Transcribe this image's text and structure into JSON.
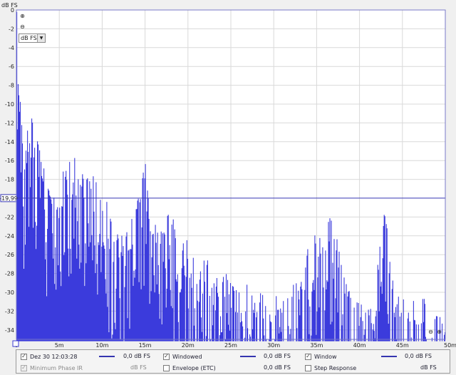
{
  "axis": {
    "y_unit": "dB FS",
    "x_unit": "s",
    "cursor_readout": "-19,99"
  },
  "unit_select": {
    "value": "dB FS"
  },
  "chart_data": {
    "type": "bar",
    "title": "",
    "ylabel": "dB FS",
    "xlabel": "s",
    "xlim": [
      0,
      50
    ],
    "ylim": [
      -35,
      0
    ],
    "y_ticks": [
      0,
      -2,
      -4,
      -6,
      -8,
      -10,
      -12,
      -14,
      -16,
      -18,
      -20,
      -22,
      -24,
      -26,
      -28,
      -30,
      -32,
      -34
    ],
    "y_tick_labels": [
      "0",
      "-2",
      "-4",
      "-6",
      "-8",
      "-10",
      "-12",
      "-14",
      "-16",
      "-18",
      "",
      "-22",
      "-24",
      "-26",
      "-28",
      "-30",
      "-32",
      "-34"
    ],
    "x_ticks": [
      0,
      5,
      10,
      15,
      20,
      25,
      30,
      35,
      40,
      45,
      50
    ],
    "x_tick_labels": [
      "0",
      "5m",
      "10m",
      "15m",
      "20m",
      "25m",
      "30m",
      "35m",
      "40m",
      "45m",
      "50m s"
    ],
    "grid": true,
    "cursor_level": -19.99,
    "series_color": "#3b3bdc",
    "envelope": [
      [
        0.0,
        -4
      ],
      [
        0.4,
        -9
      ],
      [
        1.0,
        -16
      ],
      [
        1.5,
        -10.5
      ],
      [
        2.0,
        -12
      ],
      [
        2.5,
        -14
      ],
      [
        3.0,
        -16
      ],
      [
        3.5,
        -18
      ],
      [
        4.0,
        -20
      ],
      [
        5.0,
        -19
      ],
      [
        6.0,
        -14
      ],
      [
        6.5,
        -17
      ],
      [
        7.0,
        -14.5
      ],
      [
        7.5,
        -17
      ],
      [
        8.0,
        -18
      ],
      [
        9.0,
        -17
      ],
      [
        9.5,
        -19
      ],
      [
        10.0,
        -21
      ],
      [
        10.5,
        -20
      ],
      [
        11.0,
        -22
      ],
      [
        12.0,
        -24
      ],
      [
        13.0,
        -22
      ],
      [
        14.0,
        -21
      ],
      [
        14.5,
        -17
      ],
      [
        15.0,
        -16
      ],
      [
        15.5,
        -19
      ],
      [
        16.0,
        -22
      ],
      [
        17.0,
        -23
      ],
      [
        18.0,
        -21
      ],
      [
        18.5,
        -23
      ],
      [
        19.0,
        -25
      ],
      [
        20.0,
        -24
      ],
      [
        21.0,
        -27
      ],
      [
        22.0,
        -26
      ],
      [
        23.0,
        -28
      ],
      [
        24.0,
        -27
      ],
      [
        25.0,
        -29
      ],
      [
        26.0,
        -30
      ],
      [
        27.0,
        -29
      ],
      [
        28.0,
        -31
      ],
      [
        29.0,
        -29
      ],
      [
        30.0,
        -30
      ],
      [
        31.0,
        -31
      ],
      [
        32.0,
        -30
      ],
      [
        33.0,
        -27
      ],
      [
        33.5,
        -29
      ],
      [
        34.0,
        -25
      ],
      [
        34.5,
        -23
      ],
      [
        35.0,
        -22
      ],
      [
        35.5,
        -24
      ],
      [
        36.0,
        -23
      ],
      [
        36.5,
        -21
      ],
      [
        37.0,
        -22
      ],
      [
        37.5,
        -24
      ],
      [
        38.0,
        -28
      ],
      [
        39.0,
        -30
      ],
      [
        40.0,
        -31
      ],
      [
        41.0,
        -32
      ],
      [
        42.0,
        -28
      ],
      [
        42.5,
        -24
      ],
      [
        43.0,
        -21
      ],
      [
        43.5,
        -26
      ],
      [
        44.0,
        -29
      ],
      [
        45.0,
        -30
      ],
      [
        46.0,
        -31
      ],
      [
        47.0,
        -30
      ],
      [
        48.0,
        -31
      ],
      [
        49.0,
        -32
      ],
      [
        50.0,
        -33
      ]
    ]
  },
  "legend": {
    "row1": [
      {
        "label": "Dez 30 12:03:28",
        "checked": true,
        "value": "0,0 dB FS"
      },
      {
        "label": "Windowed",
        "checked": true,
        "value": "0,0 dB FS"
      },
      {
        "label": "Window",
        "checked": true,
        "value": "0,0 dB FS"
      }
    ],
    "row2": [
      {
        "label": "Minimum Phase IR",
        "checked": true,
        "disabled": true,
        "value": "dB FS"
      },
      {
        "label": "Envelope (ETC)",
        "checked": false,
        "value": "0,0 dB FS"
      },
      {
        "label": "Step Response",
        "checked": false,
        "value": "dB FS"
      }
    ],
    "line_color": "#3535b0"
  }
}
